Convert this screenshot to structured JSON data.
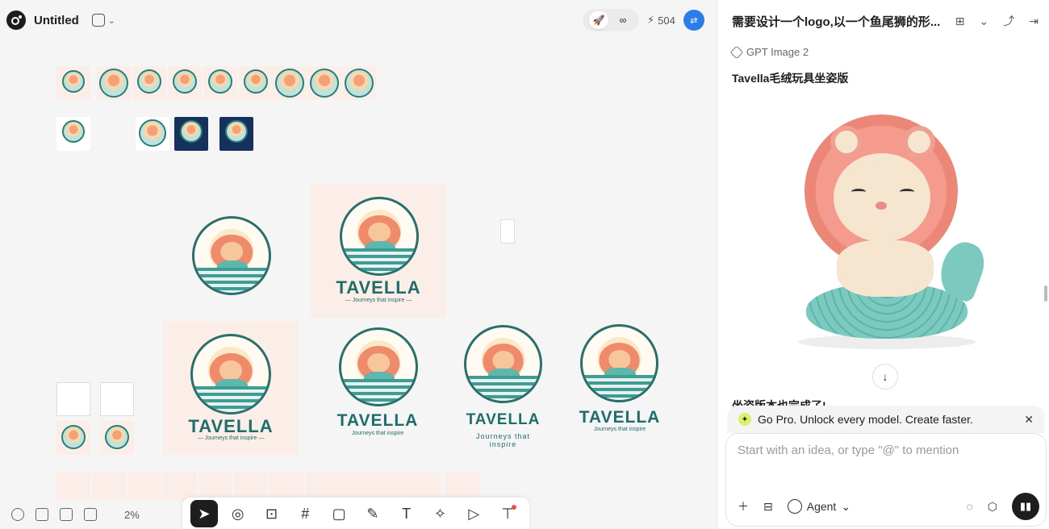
{
  "canvas": {
    "doc_title": "Untitled",
    "credits": "504",
    "zoom": "2%",
    "logos": [
      {
        "wordmark": "TAVELLA",
        "tagline": "— Journeys that inspire —"
      },
      {
        "wordmark": "TAVELLA",
        "tagline": "— Journeys that inspire —"
      },
      {
        "wordmark": "TAVELLA",
        "tagline": "Journeys that inspire"
      },
      {
        "wordmark": "TAVELLA",
        "tagline": "Journeys that inspire"
      },
      {
        "wordmark": "TAVELLA",
        "tagline": "Journeys that inspire"
      }
    ]
  },
  "toolbar": {
    "tools": [
      "select-tool",
      "pin-tool",
      "image-upload-tool",
      "frame-tool",
      "rectangle-tool",
      "pen-tool",
      "text-tool",
      "image-gen-tool",
      "video-gen-tool",
      "ai-text-tool"
    ]
  },
  "panel": {
    "title": "需要设计一个logo,以一个鱼尾狮的形...",
    "model": "GPT Image 2",
    "heading": "Tavella毛绒玩具坐姿版",
    "cut_text": "坐姿版本也完成了!",
    "promo": "Go Pro. Unlock every model. Create faster.",
    "composer_placeholder": "Start with an idea, or type \"@\" to mention",
    "agent_label": "Agent"
  },
  "colors": {
    "accent": "#1d1d1f",
    "teal": "#2a7d76",
    "coral": "#ef8a6a",
    "avatar": "#2b7de9",
    "promo_star": "#d9f26b"
  }
}
